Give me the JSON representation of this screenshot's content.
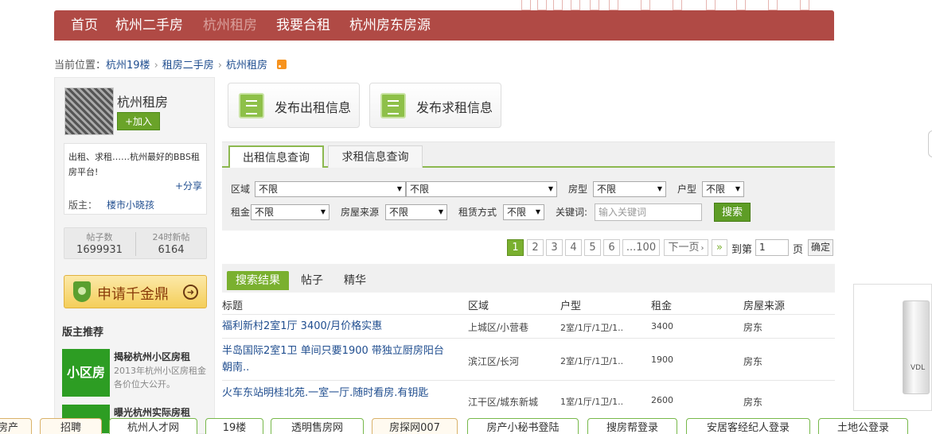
{
  "nav": {
    "items": [
      "首页",
      "杭州二手房",
      "杭州租房",
      "我要合租",
      "杭州房东房源"
    ]
  },
  "breadcrumb": {
    "prefix": "当前位置：",
    "items": [
      "杭州19楼",
      "租房二手房",
      "杭州租房"
    ]
  },
  "sidebar": {
    "forum_name": "杭州租房",
    "join_label": "+加入",
    "description": "出租、求租……杭州最好的BBS租房平台!",
    "share_label": "+分享",
    "moderator_label": "版主：",
    "moderator_name": "楼市小晓孩",
    "stats": [
      {
        "label": "帖子数",
        "value": "1699931"
      },
      {
        "label": "24时新帖",
        "value": "6164"
      }
    ],
    "apply_label": "申请千金鼎",
    "rec_title": "版主推荐",
    "rec_img_text": "小区房",
    "rec_items": [
      {
        "title": "揭秘杭州小区房租",
        "desc": "2013年杭州小区房租金各价位大公开。"
      },
      {
        "title": "曝光杭州实际房租",
        "desc": ""
      }
    ]
  },
  "publish": {
    "rent_out": "发布出租信息",
    "rent_seek": "发布求租信息"
  },
  "search": {
    "tabs": [
      "出租信息查询",
      "求租信息查询"
    ],
    "area_label": "区域",
    "area_value1": "不限",
    "area_value2": "不限",
    "room_type_label": "房型",
    "room_type_value": "不限",
    "unit_label": "户型",
    "unit_value": "不限",
    "rent_label": "租金",
    "rent_value": "不限",
    "source_label": "房屋来源",
    "source_value": "不限",
    "mode_label": "租赁方式",
    "mode_value": "不限",
    "keyword_label": "关键词:",
    "keyword_placeholder": "输入关键词",
    "search_button": "搜索"
  },
  "pagination": {
    "pages": [
      "1",
      "2",
      "3",
      "4",
      "5",
      "6",
      "...100"
    ],
    "next_label": "下一页",
    "last_label": "»",
    "goto_label": "到第",
    "goto_value": "1",
    "page_unit": "页",
    "confirm_label": "确定"
  },
  "results": {
    "tabs": [
      "搜索结果",
      "帖子",
      "精华"
    ],
    "columns": [
      "标题",
      "区域",
      "户型",
      "租金",
      "房屋来源"
    ],
    "rows": [
      {
        "title": "福利新村2室1厅 3400/月价格实惠",
        "area": "上城区/小营巷",
        "unit": "2室/1厅/1卫/1..",
        "rent": "3400",
        "source": "房东"
      },
      {
        "title": "半岛国际2室1卫 单间只要1900 带独立厨房阳台 朝南..",
        "area": "滨江区/长河",
        "unit": "2室/1厅/1卫/1..",
        "rent": "1900",
        "source": "房东"
      },
      {
        "title": "火车东站明桂北苑.一室一厅.随时看房.有钥匙",
        "area": "江干区/城东新城",
        "unit": "1室/1厅/1卫/1..",
        "rent": "2600",
        "source": "房东"
      }
    ]
  },
  "ad": {
    "brand": "VDL"
  },
  "footer": {
    "items": [
      "房产",
      "招聘",
      "杭州人才网",
      "19楼",
      "透明售房网",
      "房探网007",
      "房产小秘书登陆",
      "搜房帮登录",
      "安居客经纪人登录",
      "土地公登录"
    ]
  },
  "colors": {
    "nav_bg": "#b04a45",
    "accent_green": "#7ab02f",
    "link_blue": "#1f4d8f"
  }
}
